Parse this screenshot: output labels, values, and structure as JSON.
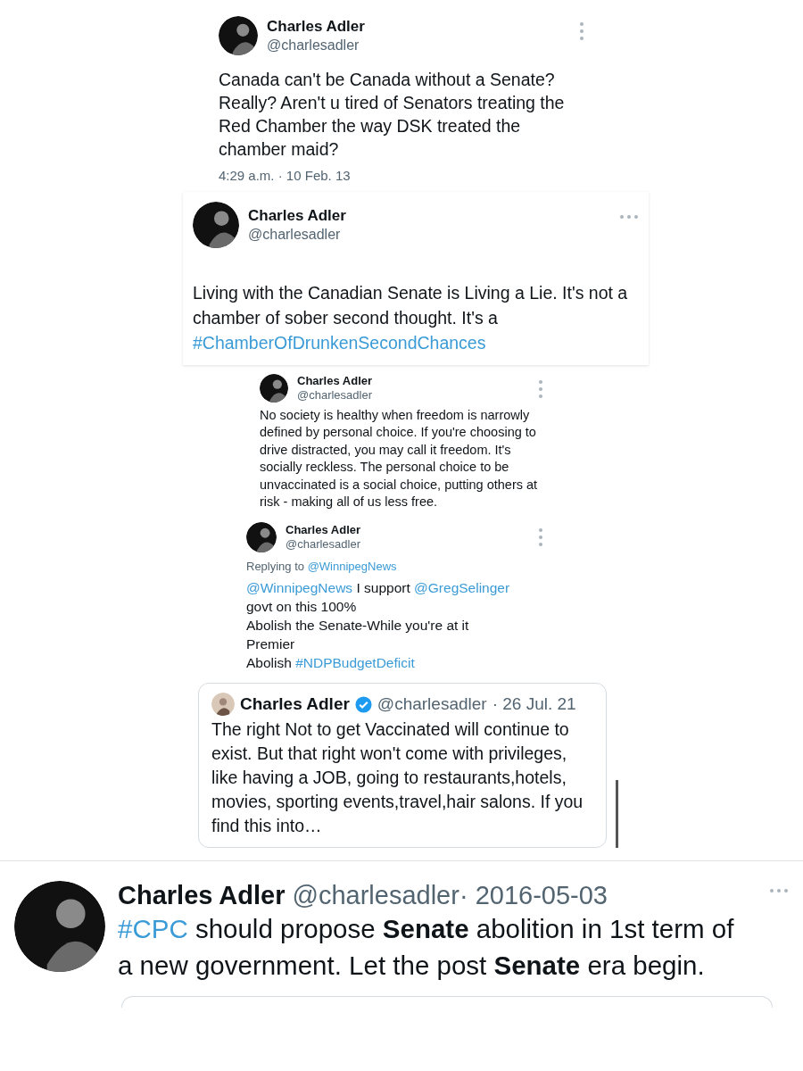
{
  "posts": [
    {
      "kind": "tweet",
      "menu": {
        "kind": "vertical"
      },
      "author": "Charles Adler",
      "handle": "@charlesadler",
      "text": [
        {
          "kind": "plain",
          "text": "Canada can't be Canada without a Senate? Really? Aren't u tired of Senators treating the Red Chamber the way DSK treated the chamber maid?"
        }
      ],
      "timestamp": "4:29 a.m. · 10 Feb. 13"
    },
    {
      "kind": "tweet",
      "menu": {
        "kind": "horizontal"
      },
      "author": "Charles Adler",
      "handle": "@charlesadler",
      "text": [
        {
          "kind": "plain",
          "text": "Living with the Canadian Senate is Living a Lie.  It's not a chamber of sober second thought. It's a "
        },
        {
          "kind": "hashtag",
          "text": "#ChamberOfDrunkenSecondChances"
        }
      ]
    },
    {
      "kind": "tweet",
      "menu": {
        "kind": "vertical"
      },
      "author": "Charles Adler",
      "handle": "@charlesadler",
      "text": [
        {
          "kind": "plain",
          "text": "No society is healthy when freedom is narrowly defined by personal choice. If you're choosing to drive distracted, you may call it freedom. It's socially reckless. The personal choice to be unvaccinated is a social choice, putting others at risk - making all of us less free."
        }
      ]
    },
    {
      "kind": "tweet",
      "menu": {
        "kind": "vertical"
      },
      "author": "Charles Adler",
      "handle": "@charlesadler",
      "replying": [
        {
          "kind": "plain",
          "text": "Replying to "
        },
        {
          "kind": "mention",
          "text": "@WinnipegNews"
        }
      ],
      "text": [
        {
          "kind": "mention",
          "text": "@WinnipegNews"
        },
        {
          "kind": "plain",
          "text": "  I support "
        },
        {
          "kind": "mention",
          "text": "@GregSelinger"
        },
        {
          "kind": "plain",
          "text": "\ngovt on this 100%\nAbolish the Senate-While you're at it\nPremier\nAbolish "
        },
        {
          "kind": "hashtag",
          "text": "#NDPBudgetDeficit"
        }
      ]
    },
    {
      "kind": "quote",
      "verified": true,
      "author": "Charles Adler",
      "handle": "@charlesadler",
      "date": "· 26 Jul. 21",
      "text": [
        {
          "kind": "plain",
          "text": "The right Not to get Vaccinated will continue to exist. But that right won't come with privileges, like having a JOB, going to restaurants,hotels, movies, sporting events,travel,hair salons. If you find this into…"
        }
      ]
    },
    {
      "kind": "inline",
      "menu": {
        "kind": "horizontal"
      },
      "author": "Charles Adler",
      "handle": "@charlesadler",
      "date": "· 2016-05-03",
      "text": [
        {
          "kind": "hashtag",
          "text": "#CPC"
        },
        {
          "kind": "plain",
          "text": " should propose "
        },
        {
          "kind": "bold",
          "text": "Senate"
        },
        {
          "kind": "plain",
          "text": " abolition in 1st term of a new government. Let the post "
        },
        {
          "kind": "bold",
          "text": "Senate"
        },
        {
          "kind": "plain",
          "text": " era begin."
        }
      ]
    }
  ]
}
